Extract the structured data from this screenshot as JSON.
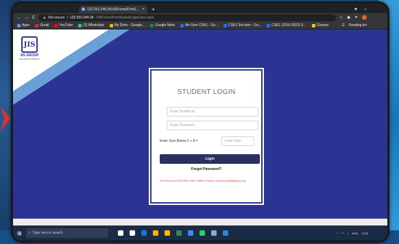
{
  "browser": {
    "tab_title": "122.252.249.26/JISForms/FrmS...",
    "tab_close": "×",
    "new_tab": "+",
    "nav": {
      "back": "←",
      "forward": "→",
      "reload": "C"
    },
    "url": {
      "security": "Not secure",
      "host": "122.252.249.26",
      "path": "/JISForms/FrmStudentLoginUser.aspx"
    },
    "bookmarks": [
      {
        "label": "Apps",
        "color": "#5f8ee8"
      },
      {
        "label": "Gmail",
        "color": "#d93025"
      },
      {
        "label": "YouTube",
        "color": "#ff0000"
      },
      {
        "label": "(3) WhatsApp",
        "color": "#25d366"
      },
      {
        "label": "My Drive - Google...",
        "color": "#f4b400"
      },
      {
        "label": "Google Meet",
        "color": "#00897b"
      },
      {
        "label": "4th Sem CSE1 - Go...",
        "color": "#1a73e8"
      },
      {
        "label": "CSE1 3rd sem - Go...",
        "color": "#1a73e8"
      },
      {
        "label": "CSE1 (2019-2023) S...",
        "color": "#1a73e8"
      },
      {
        "label": "Classes",
        "color": "#f6bf26"
      }
    ],
    "reading_list": "Reading list"
  },
  "logo": {
    "mark": "JIS",
    "text": "JIS GROUP",
    "sub": "Educational Initiatives"
  },
  "login": {
    "title": "STUDENT LOGIN",
    "student_id_placeholder": "Enter Student id",
    "password_placeholder": "Enter Password",
    "sum_label": "Enter Sum Below 2 + 8 =",
    "sum_placeholder": "Enter Sum",
    "login_button": "Login",
    "forgot": "Forgot Password?",
    "note": "For Help Call on 033-2552-1969 / 1968 or Email to econnect.gnit@jisgroup.org"
  },
  "taskbar": {
    "search_placeholder": "Type here to search",
    "app_colors": [
      "#ffffff",
      "#ffffff",
      "#0f7ad8",
      "#f4b400",
      "#ffb900",
      "#2e8b57",
      "#3c8df2",
      "#25d366",
      "#8fa8c6",
      "#2b88d8"
    ],
    "time": "17:32",
    "lang": "ENG"
  }
}
